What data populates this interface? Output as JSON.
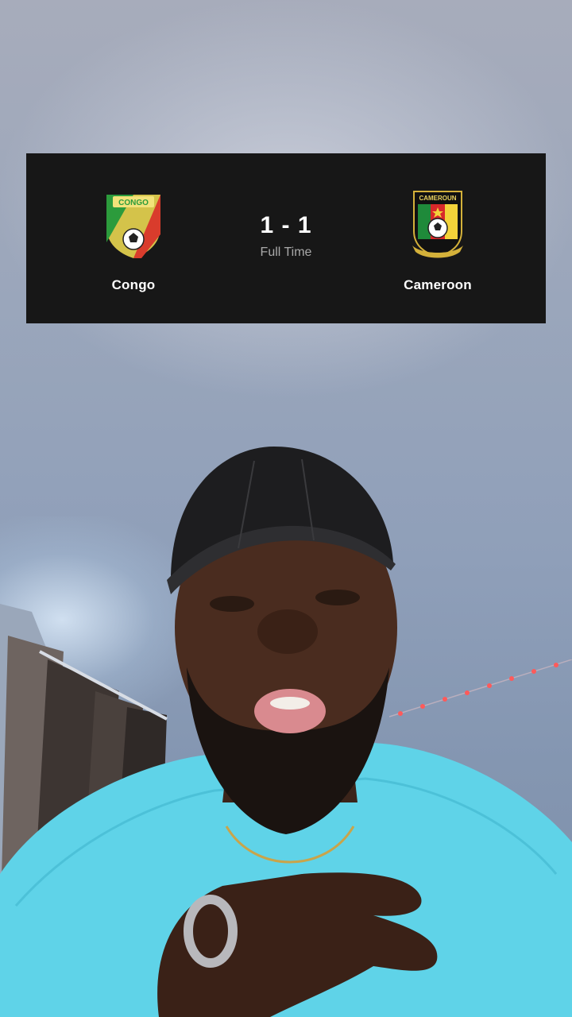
{
  "match": {
    "home_team": {
      "name": "Congo",
      "crest_icon": "congo-football-crest-icon",
      "crest_text": "CONGO"
    },
    "away_team": {
      "name": "Cameroon",
      "crest_icon": "cameroon-football-crest-icon",
      "crest_text": "CAMEROUN"
    },
    "score": "1 - 1",
    "status": "Full Time"
  },
  "colors": {
    "card_background": "#171717",
    "team_name": "#ffffff",
    "status_text": "#a9a9a9",
    "shirt": "#5fd3e8"
  }
}
